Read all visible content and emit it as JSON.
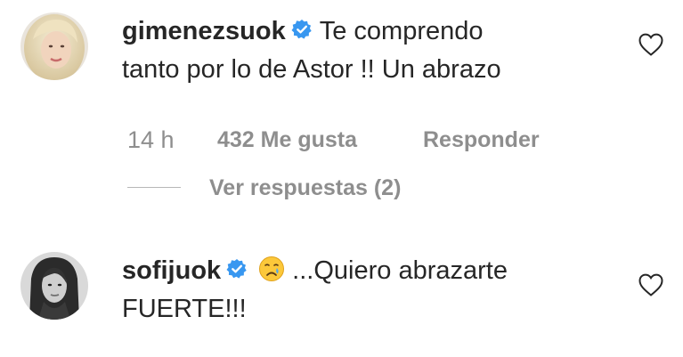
{
  "comments": [
    {
      "username": "gimenezsuok",
      "verified": true,
      "text_line1": "Te comprendo",
      "text_line2": "tanto por lo de Astor !! Un abrazo",
      "time": "14 h",
      "likes": "432 Me gusta",
      "reply_label": "Responder",
      "view_replies": "Ver respuestas (2)",
      "like_icon": "heart-outline-icon"
    },
    {
      "username": "sofijuok",
      "verified": true,
      "emoji": "crying-face",
      "text_line1": "...Quiero abrazarte",
      "text_line2": "FUERTE!!!",
      "like_icon": "heart-outline-icon"
    }
  ],
  "colors": {
    "text": "#262626",
    "meta": "#8e8e8e",
    "verified_badge": "#3897f0"
  }
}
